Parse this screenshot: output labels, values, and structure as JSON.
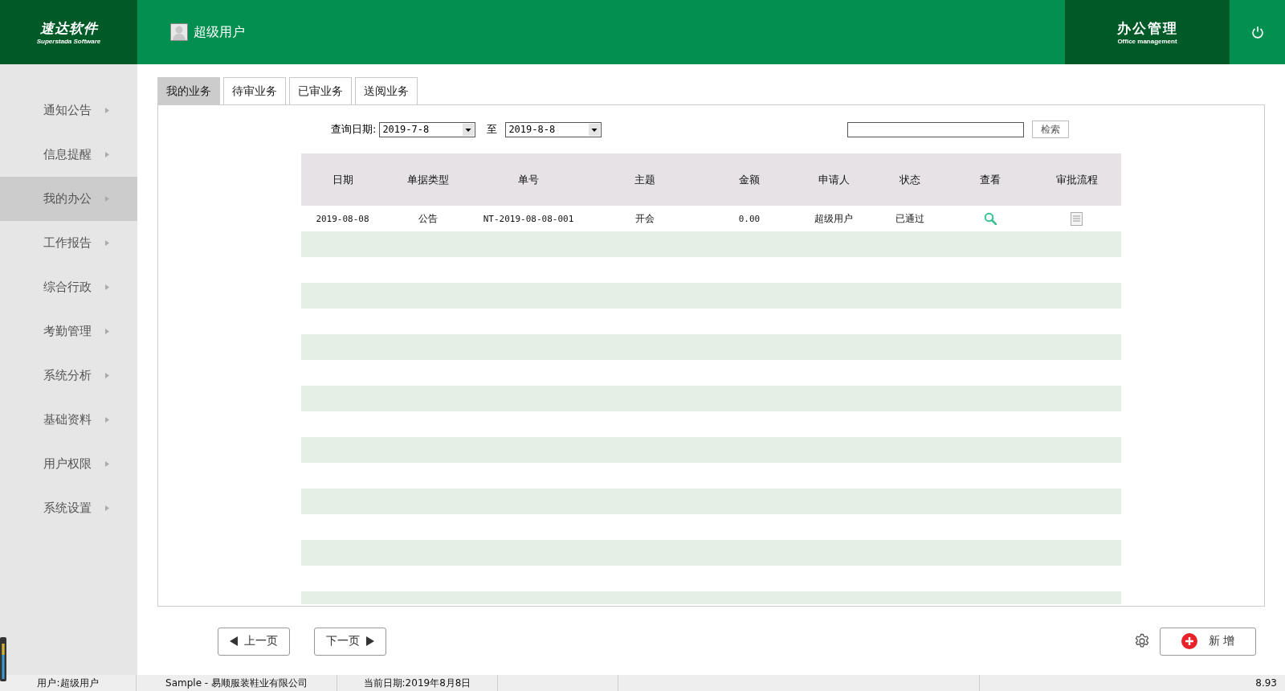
{
  "header": {
    "logo": "速达软件",
    "logo_sub": "Superstada Software",
    "user": "超级用户",
    "module": "办公管理",
    "module_sub": "Office management"
  },
  "sidebar": {
    "items": [
      {
        "label": "通知公告",
        "selected": false
      },
      {
        "label": "信息提醒",
        "selected": false
      },
      {
        "label": "我的办公",
        "selected": true
      },
      {
        "label": "工作报告",
        "selected": false
      },
      {
        "label": "综合行政",
        "selected": false
      },
      {
        "label": "考勤管理",
        "selected": false
      },
      {
        "label": "系统分析",
        "selected": false
      },
      {
        "label": "基础资料",
        "selected": false
      },
      {
        "label": "用户权限",
        "selected": false
      },
      {
        "label": "系统设置",
        "selected": false
      }
    ]
  },
  "tabs": [
    {
      "label": "我的业务",
      "selected": true
    },
    {
      "label": "待审业务",
      "selected": false
    },
    {
      "label": "已审业务",
      "selected": false
    },
    {
      "label": "送阅业务",
      "selected": false
    }
  ],
  "filter": {
    "date_label": "查询日期:",
    "date_from": "2019-7-8",
    "to_label": "至",
    "date_to": "2019-8-8",
    "search_button": "检索"
  },
  "table": {
    "columns": [
      "日期",
      "单据类型",
      "单号",
      "主题",
      "金额",
      "申请人",
      "状态",
      "查看",
      "审批流程"
    ],
    "rows": [
      {
        "cells": [
          "2019-08-08",
          "公告",
          "NT-2019-08-08-001",
          "开会",
          "0.00",
          "超级用户",
          "已通过"
        ]
      }
    ]
  },
  "pager": {
    "prev": "上一页",
    "next": "下一页"
  },
  "add_button": "新 增",
  "status_bar": [
    "用户:超级用户",
    "Sample - 易顺服装鞋业有限公司",
    "当前日期:2019年8月8日",
    "8.93"
  ]
}
